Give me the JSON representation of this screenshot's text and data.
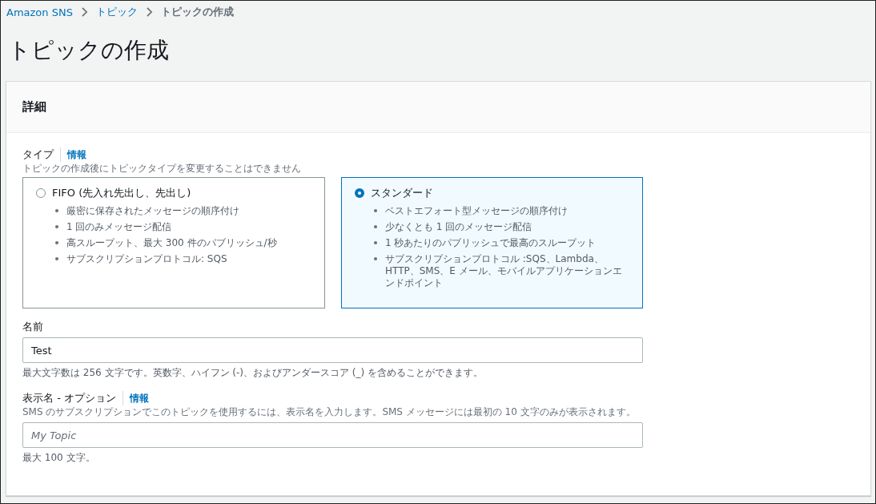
{
  "breadcrumb": [
    {
      "label": "Amazon SNS",
      "current": false
    },
    {
      "label": "トピック",
      "current": false
    },
    {
      "label": "トピックの作成",
      "current": true
    }
  ],
  "page_title": "トピックの作成",
  "panel": {
    "title": "詳細",
    "type_field": {
      "label": "タイプ",
      "info": "情報",
      "description": "トピックの作成後にトピックタイプを変更することはできません",
      "options": [
        {
          "title": "FIFO (先入れ先出し、先出し)",
          "selected": false,
          "bullets": [
            "厳密に保存されたメッセージの順序付け",
            "1 回のみメッセージ配信",
            "高スループット、最大 300 件のパブリッシュ/秒",
            "サブスクリプションプロトコル: SQS"
          ]
        },
        {
          "title": "スタンダード",
          "selected": true,
          "bullets": [
            "ベストエフォート型メッセージの順序付け",
            "少なくとも 1 回のメッセージ配信",
            "1 秒あたりのパブリッシュで最高のスループット",
            "サブスクリプションプロトコル :SQS、Lambda、HTTP、SMS、E メール、モバイルアプリケーションエンドポイント"
          ]
        }
      ]
    },
    "fields": [
      {
        "label": "名前",
        "value": "Test",
        "constraint": "最大文字数は 256 文字です。英数字、ハイフン (-)、およびアンダースコア (_) を含めることができます。"
      },
      {
        "label": "表示名 - オプション",
        "info": "情報",
        "description": "SMS のサブスクリプションでこのトピックを使用するには、表示名を入力します。SMS メッセージには最初の 10 文字のみが表示されます。",
        "placeholder": "My Topic",
        "constraint": "最大 100 文字。"
      }
    ]
  }
}
